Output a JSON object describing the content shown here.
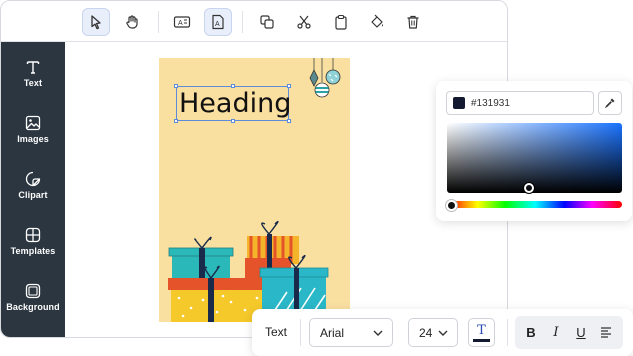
{
  "toolbar": {
    "tools": [
      {
        "icon": "select-pointer-icon",
        "active": true
      },
      {
        "icon": "hand-pan-icon",
        "active": false
      },
      {
        "icon": "text-box-icon",
        "active": false
      },
      {
        "icon": "text-image-icon",
        "active": true
      },
      {
        "icon": "duplicate-icon",
        "active": false
      },
      {
        "icon": "scissors-icon",
        "active": false
      },
      {
        "icon": "clipboard-icon",
        "active": false
      },
      {
        "icon": "paint-bucket-icon",
        "active": false
      },
      {
        "icon": "trash-icon",
        "active": false
      }
    ]
  },
  "sidebar": {
    "items": [
      {
        "label": "Text",
        "icon": "text-icon"
      },
      {
        "label": "Images",
        "icon": "image-icon"
      },
      {
        "label": "Clipart",
        "icon": "sticker-icon"
      },
      {
        "label": "Templates",
        "icon": "layout-icon"
      },
      {
        "label": "Background",
        "icon": "background-icon"
      }
    ]
  },
  "canvas": {
    "heading": "Heading",
    "card_color": "#f9e0a0"
  },
  "color_picker": {
    "hex_value": "#131931",
    "swatch_color": "#131931",
    "eyedropper_icon": "eyedropper-icon"
  },
  "text_toolbar": {
    "label": "Text",
    "font_family": "Arial",
    "font_size": "24",
    "text_color": "#131931",
    "format_buttons": [
      {
        "label": "B",
        "icon": "bold-icon"
      },
      {
        "label": "I",
        "icon": "italic-icon"
      },
      {
        "label": "U",
        "icon": "underline-icon"
      },
      {
        "label": "",
        "icon": "align-left-icon"
      }
    ]
  },
  "colors": {
    "sidebar_bg": "#2b3640",
    "accent": "#5b8bd9"
  }
}
